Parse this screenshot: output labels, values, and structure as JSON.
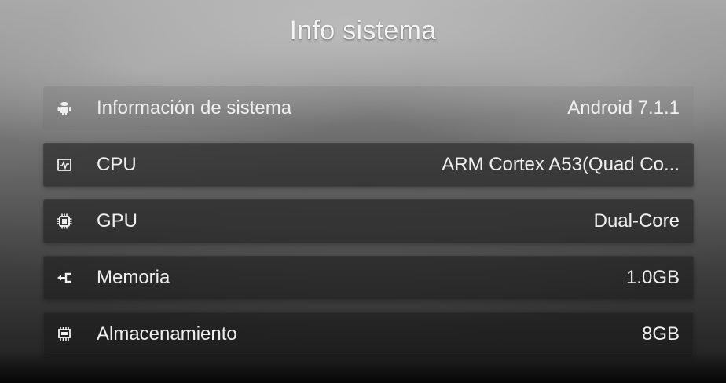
{
  "screen": {
    "title": "Info sistema"
  },
  "rows": [
    {
      "icon": "android-icon",
      "label": "Información de sistema",
      "value": "Android 7.1.1"
    },
    {
      "icon": "cpu-icon",
      "label": "CPU",
      "value": "ARM Cortex A53(Quad Co..."
    },
    {
      "icon": "gpu-chip-icon",
      "label": "GPU",
      "value": "Dual-Core"
    },
    {
      "icon": "memory-icon",
      "label": "Memoria",
      "value": "1.0GB"
    },
    {
      "icon": "storage-icon",
      "label": "Almacenamiento",
      "value": "8GB"
    }
  ],
  "colors": {
    "text": "#efefef",
    "row_background": "#191919",
    "title_text": "#f4f4f4"
  }
}
